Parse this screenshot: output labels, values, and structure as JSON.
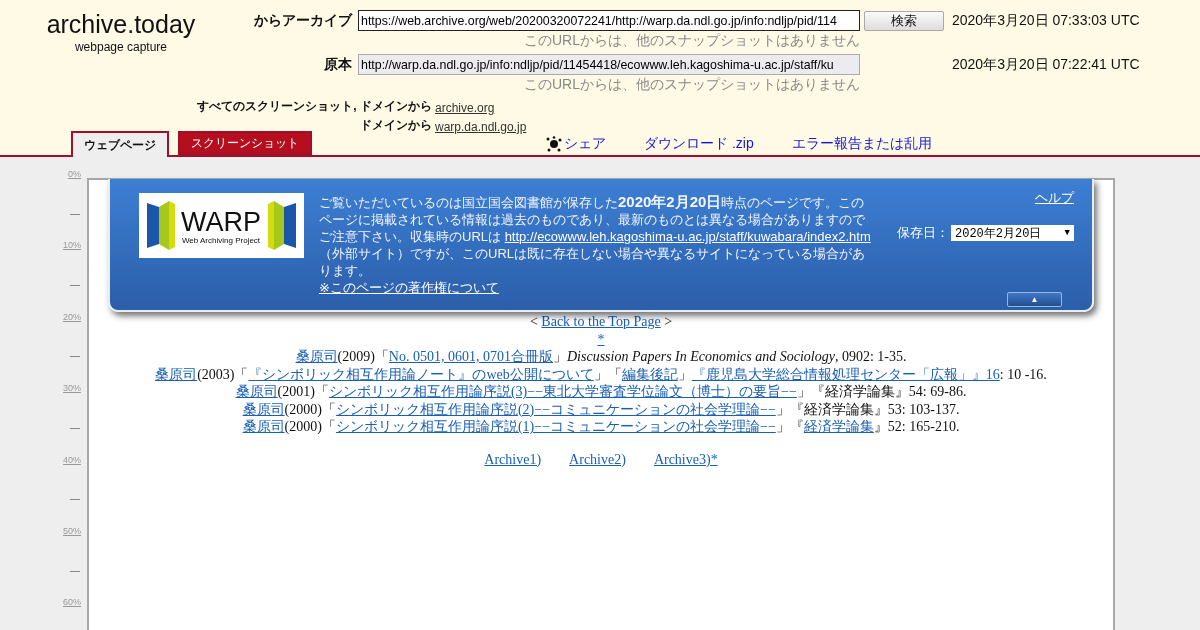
{
  "logo": {
    "title": "archive.today",
    "subtitle": "webpage capture"
  },
  "archive_row": {
    "label": "からアーカイブ",
    "value": "https://web.archive.org/web/20200320072241/http://warp.da.ndl.go.jp/info:ndljp/pid/114",
    "button": "検索",
    "date": "2020年3月20日 07:33:03 UTC",
    "note": "このURLからは、他のスナップショットはありません"
  },
  "original_row": {
    "label": "原本",
    "value": "http://warp.da.ndl.go.jp/info:ndljp/pid/11454418/ecowww.leh.kagoshima-u.ac.jp/staff/ku",
    "date": "2020年3月20日 07:22:41 UTC",
    "note": "このURLからは、他のスナップショットはありません"
  },
  "screenshot_links": [
    {
      "label": "すべてのスクリーンショット, ドメインから",
      "link": "archive.org"
    },
    {
      "label": "ドメインから",
      "link": "warp.da.ndl.go.jp"
    }
  ],
  "tabs": [
    {
      "label": "ウェブページ",
      "selected": true
    },
    {
      "label": "スクリーンショット",
      "selected": false
    }
  ],
  "actions": [
    {
      "label": "シェア",
      "kind": "share"
    },
    {
      "label": "ダウンロード .zip",
      "kind": "plain"
    },
    {
      "label": "エラー報告または乱用",
      "kind": "plain"
    }
  ],
  "ruler": [
    "0%",
    "10%",
    "20%",
    "30%",
    "40%",
    "50%",
    "60%"
  ],
  "banner": {
    "logo_title": "WARP",
    "logo_subtitle": "Web Archiving Project",
    "notice_before": "ご覧いただいているのは国立国会図書館が保存した**2020年2月20日**時点のページです。このページに掲載されている情報は過去のものであり、最新のものとは異なる場合がありますのでご注意下さい。収集時のURLは ",
    "notice_link": "http://ecowww.leh.kagoshima-u.ac.jp/staff/kuwabara/index2.htm",
    "notice_after": "（外部サイト）ですが、このURLは既に存在しない場合や異なるサイトになっている場合があります。",
    "copyright_link": "※このページの著作権について",
    "help": "ヘルプ",
    "date_label": "保存日：",
    "date_value": "2020年2月20日",
    "dropdown_caret": "▼",
    "collapse": "▲"
  },
  "content": {
    "back_link_before": "< ",
    "back_link": "Back to the Top Page",
    "back_link_after": " >",
    "star": "*",
    "citations": [
      [
        {
          "kind": "link",
          "text": "桑原司"
        },
        {
          "kind": "text",
          "text": "(2009)「"
        },
        {
          "kind": "link",
          "text": "No. 0501, 0601, 0701合冊版"
        },
        {
          "kind": "text",
          "text": "」"
        },
        {
          "kind": "italic",
          "text": "Discussion Papers In Economics and Sociology"
        },
        {
          "kind": "text",
          "text": ", 0902: 1-35."
        }
      ],
      [
        {
          "kind": "link",
          "text": "桑原司"
        },
        {
          "kind": "text",
          "text": "(2003)「"
        },
        {
          "kind": "link",
          "text": "『シンボリック相互作用論ノート』のweb公開について"
        },
        {
          "kind": "text",
          "text": "」「"
        },
        {
          "kind": "link",
          "text": "編集後記"
        },
        {
          "kind": "text",
          "text": "」"
        },
        {
          "kind": "link",
          "text": "『鹿児島大学総合情報処理センター「広報」』16"
        },
        {
          "kind": "text",
          "text": ": 10 -16."
        }
      ],
      [
        {
          "kind": "link",
          "text": "桑原司"
        },
        {
          "kind": "text",
          "text": "(2001)「"
        },
        {
          "kind": "link",
          "text": "シンボリック相互作用論序説(3)−−東北大学審査学位論文（博士）の要旨−−"
        },
        {
          "kind": "text",
          "text": "」『経済学論集』54: 69-86."
        }
      ],
      [
        {
          "kind": "link",
          "text": "桑原司"
        },
        {
          "kind": "text",
          "text": "(2000)「"
        },
        {
          "kind": "link",
          "text": "シンボリック相互作用論序説(2)−−コミュニケーションの社会学理論−−"
        },
        {
          "kind": "text",
          "text": "」『経済学論集』53: 103-137."
        }
      ],
      [
        {
          "kind": "link",
          "text": "桑原司"
        },
        {
          "kind": "text",
          "text": "(2000)「"
        },
        {
          "kind": "link",
          "text": "シンボリック相互作用論序説(1)−−コミュニケーションの社会学理論−−"
        },
        {
          "kind": "text",
          "text": "」『"
        },
        {
          "kind": "link",
          "text": "経済学論集"
        },
        {
          "kind": "text",
          "text": "』52: 165-210."
        }
      ]
    ],
    "archive_links": [
      "Archive1)",
      "Archive2)",
      "Archive3)*"
    ]
  }
}
